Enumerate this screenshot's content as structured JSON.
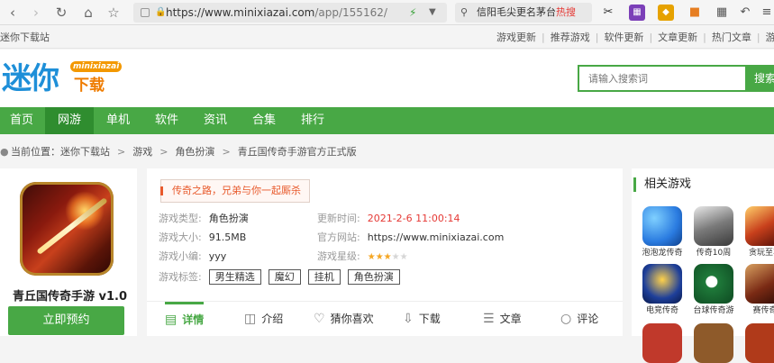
{
  "browser": {
    "url_host": "https://www.minixiazai.com",
    "url_path": "/app/155162/",
    "search_text": "信阳毛尖更名茅台",
    "search_badge": "热搜"
  },
  "topbar": {
    "site_name": "迷你下载站",
    "links": [
      "游戏更新",
      "推荐游戏",
      "软件更新",
      "文章更新",
      "热门文章",
      "游戏专"
    ]
  },
  "header": {
    "logo_main": "迷你",
    "logo_sub": "minixiazai",
    "logo_dl": "下载",
    "search_placeholder": "请输入搜索词",
    "search_button": "搜索"
  },
  "nav": {
    "items": [
      {
        "label": "首页",
        "active": false
      },
      {
        "label": "网游",
        "active": true
      },
      {
        "label": "单机",
        "active": false
      },
      {
        "label": "软件",
        "active": false
      },
      {
        "label": "资讯",
        "active": false
      },
      {
        "label": "合集",
        "active": false
      },
      {
        "label": "排行",
        "active": false
      }
    ]
  },
  "breadcrumb": {
    "prefix": "当前位置：",
    "items": [
      "迷你下载站",
      "游戏",
      "角色扮演",
      "青丘国传奇手游官方正式版"
    ],
    "separator": ">"
  },
  "app": {
    "name": "青丘国传奇手游 v1.0",
    "download_button": "立即预约",
    "slogan": "传奇之路，兄弟与你一起厮杀",
    "type_label": "游戏类型:",
    "type_value": "角色扮演",
    "size_label": "游戏大小:",
    "size_value": "91.5MB",
    "editor_label": "游戏小编:",
    "editor_value": "yyy",
    "tags_label": "游戏标签:",
    "tags": [
      "男生精选",
      "魔幻",
      "挂机",
      "角色扮演"
    ],
    "update_label": "更新时间:",
    "update_value": "2021-2-6 11:00:14",
    "site_label": "官方网站:",
    "site_value": "https://www.minixiazai.com",
    "rating_label": "游戏星级:",
    "rating": 3,
    "rating_max": 5
  },
  "tabs": [
    {
      "label": "详情",
      "icon": "detail-icon",
      "active": true
    },
    {
      "label": "介绍",
      "icon": "document-icon",
      "active": false
    },
    {
      "label": "猜你喜欢",
      "icon": "heart-icon",
      "active": false
    },
    {
      "label": "下载",
      "icon": "download-icon",
      "active": false
    },
    {
      "label": "文章",
      "icon": "layers-icon",
      "active": false
    },
    {
      "label": "评论",
      "icon": "comment-icon",
      "active": false
    }
  ],
  "sidebar": {
    "title": "相关游戏",
    "games": [
      {
        "name": "泡泡龙传奇",
        "color": "#2a7be0"
      },
      {
        "name": "传奇10周",
        "color": "#5a5a5a"
      },
      {
        "name": "贪玩至尊",
        "color": "#9a2a1a"
      },
      {
        "name": "电竞传奇",
        "color": "#1e3f9a"
      },
      {
        "name": "台球传奇游",
        "color": "#1f7a3a"
      },
      {
        "name": "赛传奇",
        "color": "#7a2a14"
      }
    ]
  },
  "colors": {
    "brand_green": "#48a845",
    "nav_active": "#2f8d2f",
    "accent_red": "#e53935",
    "star": "#f5a623"
  }
}
